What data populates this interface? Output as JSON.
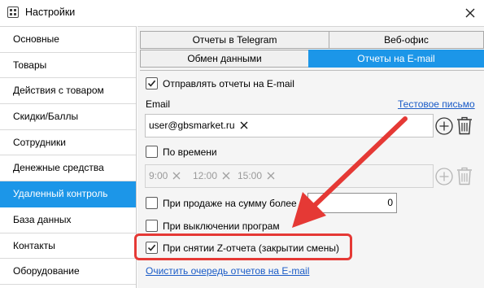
{
  "window": {
    "title": "Настройки"
  },
  "sidebar": {
    "items": [
      {
        "label": "Основные"
      },
      {
        "label": "Товары"
      },
      {
        "label": "Действия с товаром"
      },
      {
        "label": "Скидки/Баллы"
      },
      {
        "label": "Сотрудники"
      },
      {
        "label": "Денежные средства"
      },
      {
        "label": "Удаленный контроль"
      },
      {
        "label": "База данных"
      },
      {
        "label": "Контакты"
      },
      {
        "label": "Оборудование"
      }
    ],
    "active_label": "Удаленный контроль"
  },
  "tabs": {
    "row1": [
      "Отчеты в Telegram",
      "Веб-офис"
    ],
    "row2": [
      "Обмен данными",
      "Отчеты на E-mail"
    ],
    "active": "Отчеты на E-mail"
  },
  "email_reports": {
    "send_reports_label": "Отправлять отчеты на E-mail",
    "send_reports_checked": true,
    "email_label": "Email",
    "test_email_link": "Тестовое письмо",
    "email_chip": "user@gbsmarket.ru",
    "by_time_label": "По времени",
    "by_time_checked": false,
    "time_chips": [
      "9:00",
      "12:00",
      "15:00"
    ],
    "on_sale_amount_label": "При продаже на сумму более",
    "on_sale_amount_checked": false,
    "sale_amount_value": "0",
    "on_program_close_label": "При выключении програм",
    "on_program_close_checked": false,
    "on_z_report_label": "При снятии Z-отчета (закрытии смены)",
    "on_z_report_checked": true,
    "clear_queue_link": "Очистить очередь отчетов на E-mail"
  },
  "colors": {
    "accent": "#1c96e8",
    "link": "#1a5bc7",
    "annotation": "#e53935"
  },
  "icons": [
    "app-icon",
    "close-icon",
    "checkmark-icon",
    "chip-remove-icon",
    "plus-circle-icon",
    "trash-icon"
  ]
}
